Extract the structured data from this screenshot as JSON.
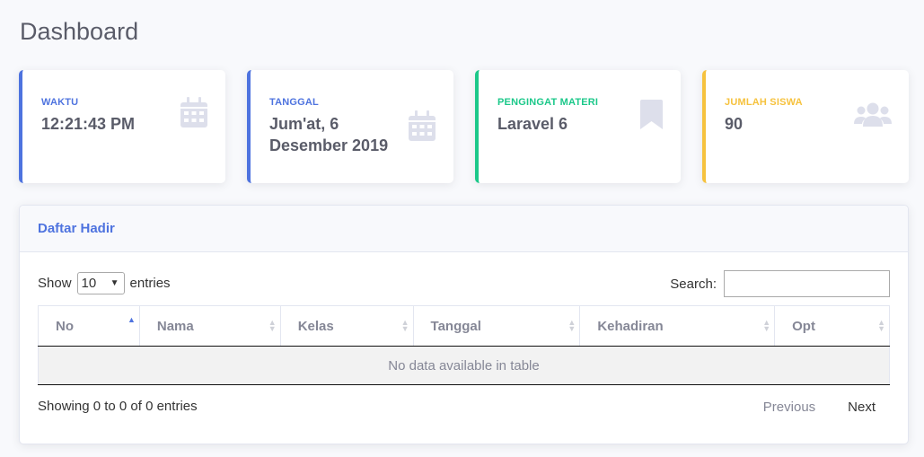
{
  "page": {
    "title": "Dashboard"
  },
  "cards": [
    {
      "label": "WAKTU",
      "value": "12:21:43 PM",
      "icon": "calendar-icon",
      "accent": "#4e73df"
    },
    {
      "label": "TANGGAL",
      "value": "Jum'at, 6 Desember 2019",
      "icon": "calendar-icon",
      "accent": "#4e73df"
    },
    {
      "label": "PENGINGAT MATERI",
      "value": "Laravel 6",
      "icon": "bookmark-icon",
      "accent": "#1cc88a"
    },
    {
      "label": "JUMLAH SISWA",
      "value": "90",
      "icon": "users-icon",
      "accent": "#f6c23e"
    }
  ],
  "panel": {
    "title": "Daftar Hadir",
    "length": {
      "show": "Show",
      "value": "10",
      "entries": "entries"
    },
    "search": {
      "label": "Search:",
      "value": ""
    },
    "columns": [
      "No",
      "Nama",
      "Kelas",
      "Tanggal",
      "Kehadiran",
      "Opt"
    ],
    "empty": "No data available in table",
    "info": "Showing 0 to 0 of 0 entries",
    "pager": {
      "prev": "Previous",
      "next": "Next"
    }
  }
}
